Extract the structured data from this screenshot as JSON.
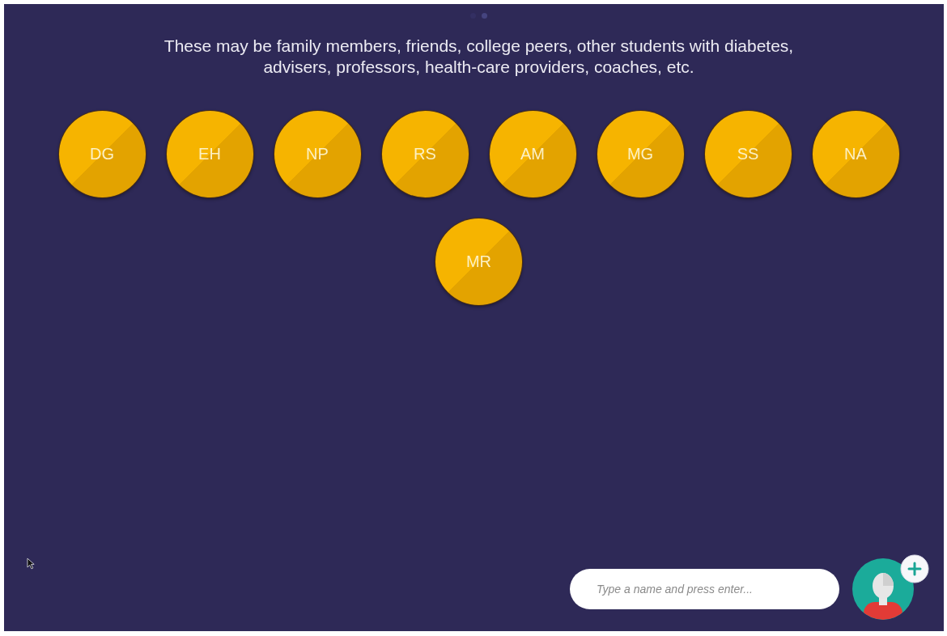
{
  "pager": [
    {
      "selected": false
    },
    {
      "selected": true
    }
  ],
  "intro": "These may be family members, friends, college peers, other students with diabetes,\nadvisers, professors, health-care providers, coaches, etc.",
  "people": [
    {
      "initials": "DG"
    },
    {
      "initials": "EH"
    },
    {
      "initials": "NP"
    },
    {
      "initials": "RS"
    },
    {
      "initials": "AM"
    },
    {
      "initials": "MG"
    },
    {
      "initials": "SS"
    },
    {
      "initials": "NA"
    },
    {
      "initials": "MR"
    }
  ],
  "name_field": {
    "placeholder": "Type a name and press enter..."
  }
}
